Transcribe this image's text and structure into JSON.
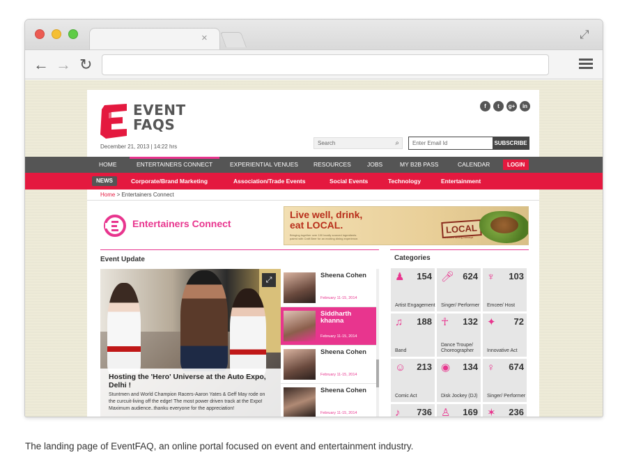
{
  "browser": {
    "tab_close": "×",
    "address": ""
  },
  "site": {
    "logo_line1": "EVENT",
    "logo_line2": "FAQS",
    "date": "December 21, 2013 | 14:22 hrs",
    "search_placeholder": "Search",
    "email_placeholder": "Enter Email Id",
    "subscribe": "SUBSCRIBE",
    "social": [
      "f",
      "t",
      "g+",
      "in"
    ]
  },
  "mainnav": {
    "items": [
      "HOME",
      "ENTERTAINERS CONNECT",
      "EXPERIENTIAL VENUES",
      "RESOURCES",
      "JOBS",
      "MY B2B PASS",
      "CALENDAR"
    ],
    "login": "LOGIN",
    "active": "ENTERTAINERS CONNECT"
  },
  "subnav": {
    "badge": "NEWS",
    "items": [
      "Corporate/Brand Marketing",
      "Association/Trade Events",
      "Social Events",
      "Technology",
      "Entertainment"
    ]
  },
  "breadcrumb": {
    "home": "Home",
    "sep": " > ",
    "current": "Entertainers Connect"
  },
  "section_title": "Entertainers Connect",
  "ad": {
    "headline1": "Live well, drink,",
    "headline2": "eat LOCAL.",
    "small": "Bringing together over 100 locally sourced ingredients paired with Craft Beer for an exciting dining experience.",
    "brand": "LOCAL",
    "brand_sub": "creative dining concept"
  },
  "event_update": {
    "title": "Event Update",
    "hero_title": "Hosting the 'Hero' Universe at the Auto Expo, Delhi !",
    "hero_desc": "Stuntmen and World Champion Racers-Aaron Yates & Geff May rode on the curcuit-living off the edge! The most power driven track at the Expo! Maximum audience..thanku everyone for the appreciation!",
    "list": [
      {
        "name": "Sheena Cohen",
        "date": "February 11-15, 2014"
      },
      {
        "name": "Siddharth khanna",
        "date": "February 11-15, 2014"
      },
      {
        "name": "Sheena Cohen",
        "date": "February 11-15, 2014"
      },
      {
        "name": "Sheena Cohen",
        "date": "February 11-15, 2014"
      }
    ]
  },
  "categories": {
    "title": "Categories",
    "items": [
      {
        "count": "154",
        "label": "Artist Engagement",
        "icon": "user-icon"
      },
      {
        "count": "624",
        "label": "Singer/ Performer",
        "icon": "microphone-icon"
      },
      {
        "count": "103",
        "label": "Emcee/ Host",
        "icon": "mic-stand-icon"
      },
      {
        "count": "188",
        "label": "Band",
        "icon": "drums-icon"
      },
      {
        "count": "132",
        "label": "Dance Troupe/ Choreographer",
        "icon": "dancers-icon"
      },
      {
        "count": "72",
        "label": "Innovative Act",
        "icon": "magic-wand-icon"
      },
      {
        "count": "213",
        "label": "Comic Act",
        "icon": "comic-face-icon"
      },
      {
        "count": "134",
        "label": "Disk Jockey (DJ)",
        "icon": "headphones-icon"
      },
      {
        "count": "674",
        "label": "Singer/ Performer",
        "icon": "singer-icon"
      },
      {
        "count": "736",
        "label": "",
        "icon": "guitar-icon"
      },
      {
        "count": "169",
        "label": "",
        "icon": "performer-icon"
      },
      {
        "count": "236",
        "label": "",
        "icon": "acrobat-icon"
      }
    ]
  },
  "caption": "The landing page of EventFAQ, an online portal focused on event and entertainment industry.",
  "colors": {
    "accent": "#e8358e",
    "red": "#e4193f",
    "nav": "#555555"
  }
}
